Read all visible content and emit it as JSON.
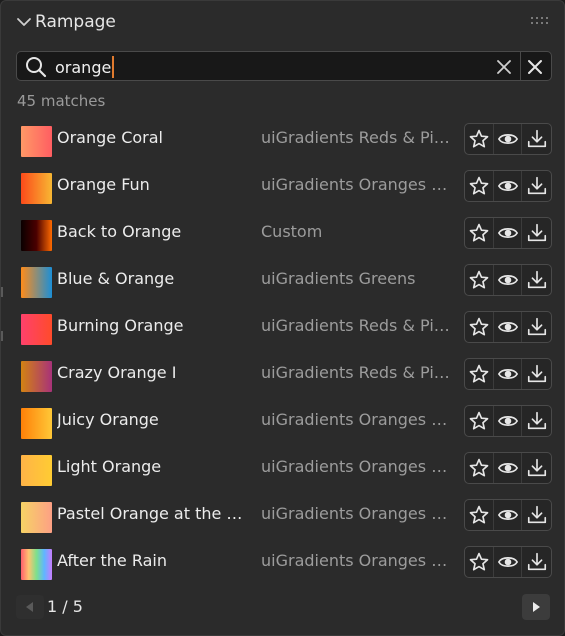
{
  "panel": {
    "title": "Rampage",
    "icons": {
      "collapse": "chevron-down-icon",
      "grip": "drag-grip-icon"
    }
  },
  "search": {
    "value": "orange",
    "icons": {
      "search": "search-icon",
      "clear": "clear-icon",
      "close": "close-icon"
    }
  },
  "results": {
    "count_label": "45 matches",
    "items": [
      {
        "name": "Orange Coral",
        "collection": "uiGradients Reds & Pi…",
        "colors": [
          "#ff9966",
          "#ff5e62"
        ]
      },
      {
        "name": "Orange Fun",
        "collection": "uiGradients Oranges …",
        "colors": [
          "#fc4a1a",
          "#f7b733"
        ]
      },
      {
        "name": "Back to Orange",
        "collection": "Custom",
        "colors": [
          "#0a0000",
          "#4a0000",
          "#ff6a00"
        ]
      },
      {
        "name": "Blue & Orange",
        "collection": "uiGradients Greens",
        "colors": [
          "#ff8c1a",
          "#1c8fd6"
        ]
      },
      {
        "name": "Burning Orange",
        "collection": "uiGradients Reds & Pi…",
        "colors": [
          "#ff416c",
          "#ff4b2b"
        ]
      },
      {
        "name": "Crazy Orange I",
        "collection": "uiGradients Reds & Pi…",
        "colors": [
          "#d38312",
          "#a83279"
        ]
      },
      {
        "name": "Juicy Orange",
        "collection": "uiGradients Oranges …",
        "colors": [
          "#ff8008",
          "#ffc837"
        ]
      },
      {
        "name": "Light Orange",
        "collection": "uiGradients Oranges …",
        "colors": [
          "#ffb347",
          "#ffcc33"
        ]
      },
      {
        "name": "Pastel Orange at the …",
        "collection": "uiGradients Oranges …",
        "colors": [
          "#f6d365",
          "#fda085"
        ]
      },
      {
        "name": "After the Rain",
        "collection": "uiGradients Oranges …",
        "colors": [
          "#ff5f6d",
          "#ffc371",
          "#7ee08a",
          "#5fb6ff",
          "#c77dff"
        ]
      }
    ],
    "row_actions": {
      "favorite": "star-icon",
      "preview": "eye-icon",
      "import": "download-icon"
    }
  },
  "pagination": {
    "label": "1 / 5",
    "icons": {
      "prev": "triangle-left-icon",
      "next": "triangle-right-icon"
    }
  },
  "colors": {
    "accent_caret": "#e07a2e",
    "panel_bg": "#2b2b2b",
    "field_bg": "#181818"
  }
}
